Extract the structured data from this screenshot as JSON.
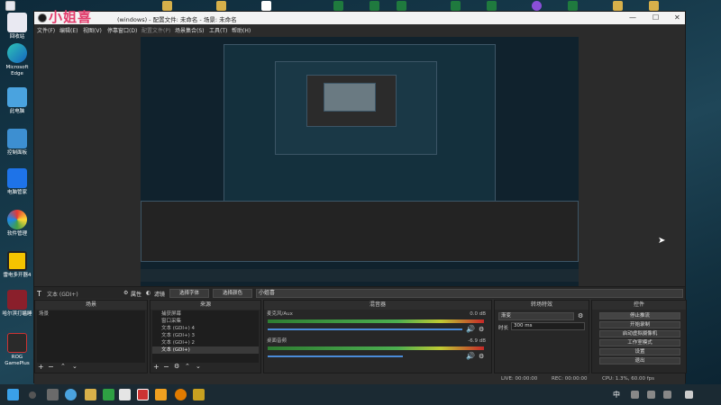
{
  "desktop": {
    "icons": [
      {
        "label": "回收站"
      },
      {
        "label": "Microsoft Edge"
      },
      {
        "label": "此电脑"
      },
      {
        "label": "控制面板"
      },
      {
        "label": "电脑管家"
      },
      {
        "label": "软件管理"
      },
      {
        "label": "雷电多开器4"
      },
      {
        "label": "哈尔滨打瞌睡"
      },
      {
        "label": "ROG GamePlus"
      }
    ]
  },
  "window": {
    "logo_text": "小姐喜",
    "title": "(windows) - 配置文件: 未命名 - 场景: 未命名",
    "menu": [
      "文件(F)",
      "编辑(E)",
      "视图(V)",
      "停靠窗口(D)",
      "配置文件(P)",
      "场景集合(S)",
      "工具(T)",
      "帮助(H)"
    ]
  },
  "source_toolbar": {
    "source_name": "文本 (GDI+)",
    "properties": "属性",
    "filters": "滤镜",
    "select_font": "选择字体",
    "select_color": "选择颜色",
    "text_value": "小姐喜"
  },
  "docks": {
    "scenes": {
      "title": "场景",
      "items": [
        "场景"
      ]
    },
    "sources": {
      "title": "来源",
      "items": [
        "捕获屏幕",
        "窗口采集",
        "文本 (GDI+) 4",
        "文本 (GDI+) 3",
        "文本 (GDI+) 2",
        "文本 (GDI+)"
      ]
    },
    "mixer": {
      "title": "混音器",
      "channels": [
        {
          "name": "麦克风/Aux",
          "db": "0.0 dB"
        },
        {
          "name": "桌面音频",
          "db": "-6.9 dB"
        }
      ]
    },
    "transitions": {
      "title": "转场特效",
      "type": "渐变",
      "duration_label": "时长",
      "duration": "300 ms"
    },
    "controls": {
      "title": "控件",
      "buttons": [
        "停止推流",
        "开始录制",
        "启动虚拟摄像机",
        "工作室模式",
        "设置",
        "退出"
      ]
    }
  },
  "status": {
    "live": "LIVE: 00:00:00",
    "rec": "REC: 00:00:00",
    "cpu": "CPU: 1.3%, 60.00 fps"
  },
  "taskbar": {
    "ime": "中"
  }
}
